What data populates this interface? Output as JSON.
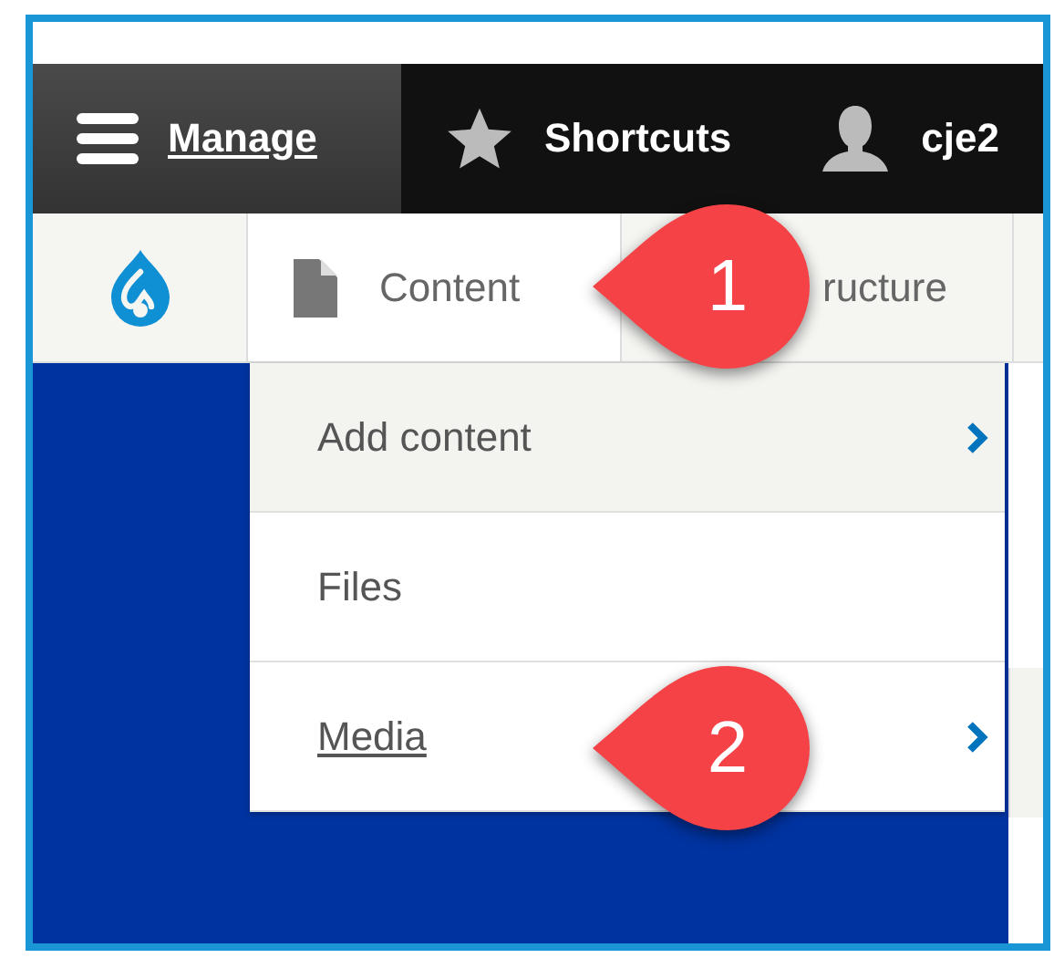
{
  "toolbar": {
    "tabs": [
      {
        "kind": "menu",
        "label": "Manage",
        "selected": true
      },
      {
        "kind": "star",
        "label": "Shortcuts",
        "selected": false
      },
      {
        "kind": "user",
        "label": "cje2",
        "selected": false
      }
    ]
  },
  "tray": {
    "tabs": [
      {
        "kind": "content",
        "label": "Content",
        "selected": true
      },
      {
        "kind": "plain",
        "label": "ructure",
        "selected": false
      }
    ]
  },
  "menu": {
    "items": [
      {
        "label": "Add content",
        "highlighted": true,
        "focused": false,
        "has_children": true
      },
      {
        "label": "Files",
        "highlighted": false,
        "focused": false,
        "has_children": false
      },
      {
        "label": "Media",
        "highlighted": false,
        "focused": true,
        "has_children": true
      }
    ]
  },
  "callouts": [
    {
      "number": "1"
    },
    {
      "number": "2"
    }
  ]
}
